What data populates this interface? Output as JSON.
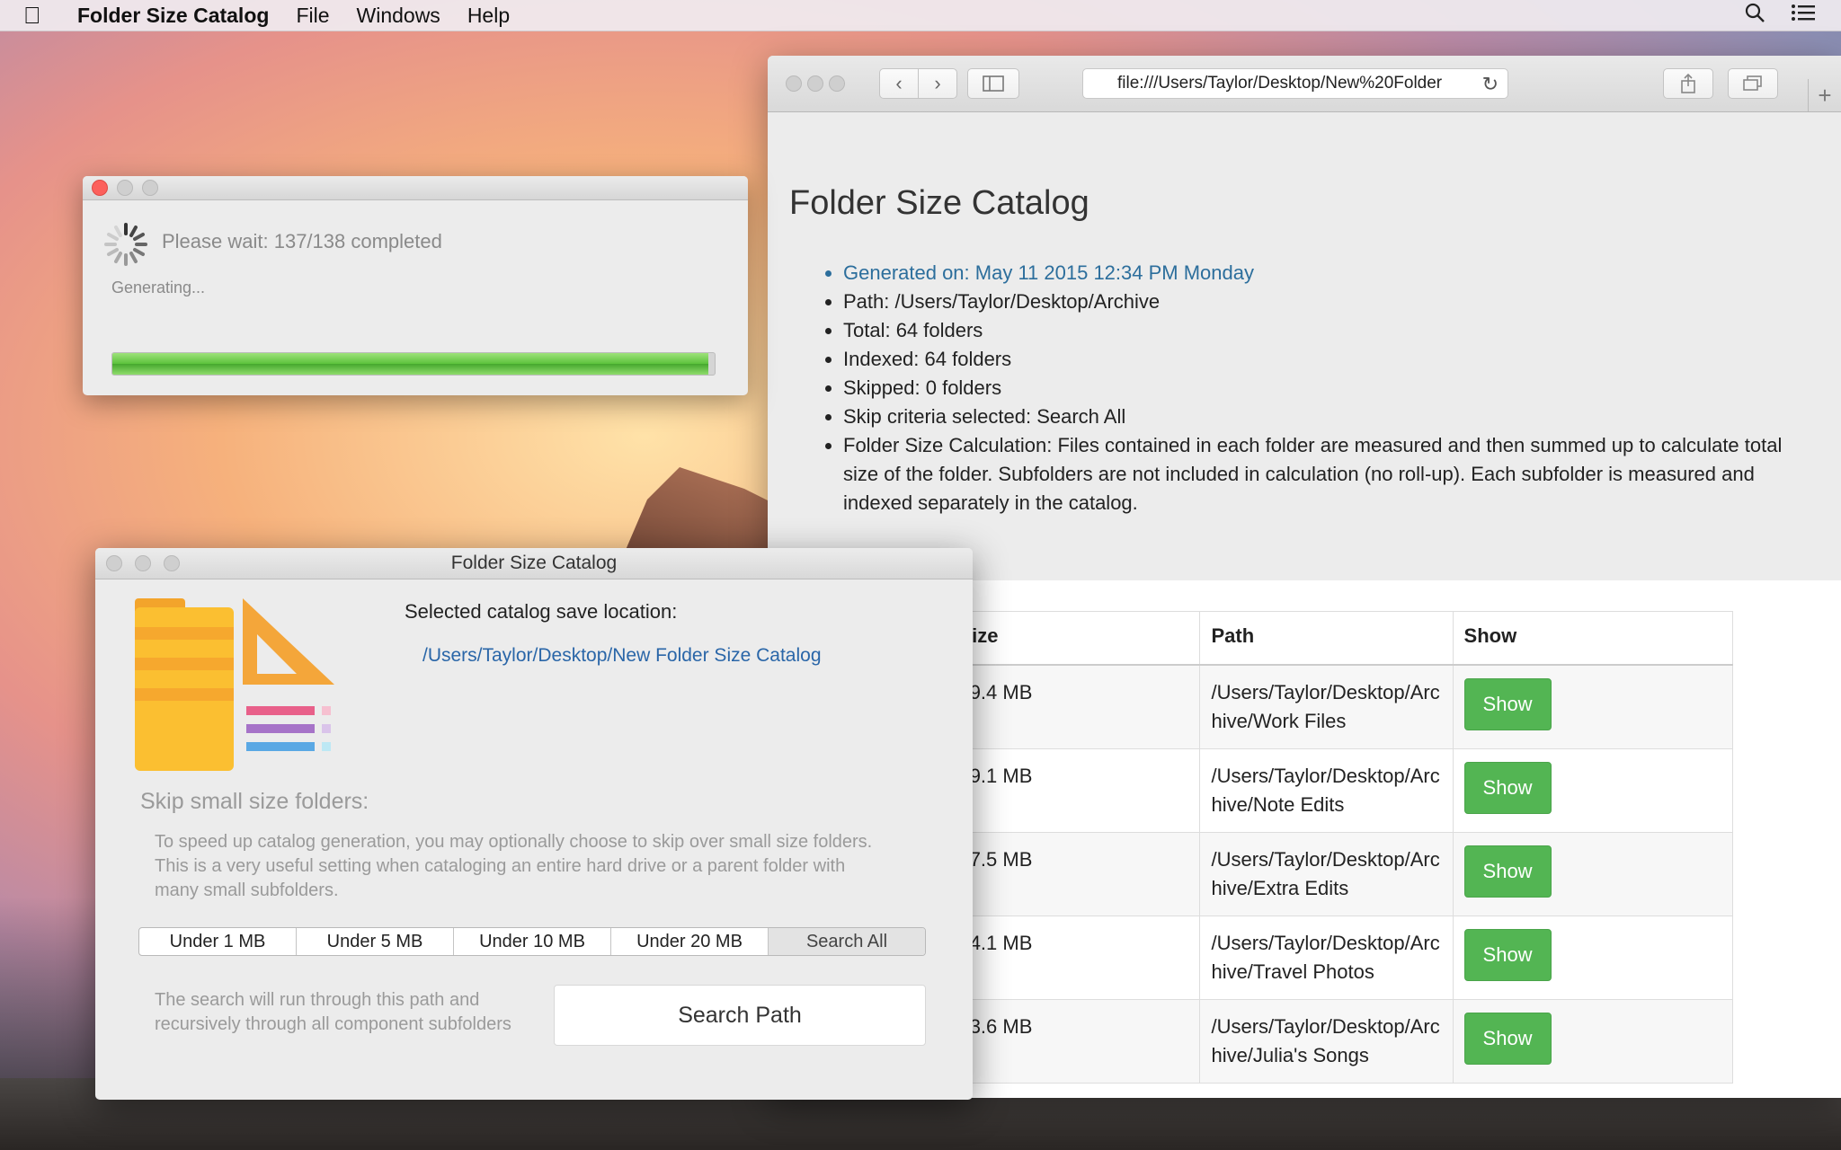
{
  "menubar": {
    "app_name": "Folder Size Catalog",
    "items": [
      "File",
      "Windows",
      "Help"
    ]
  },
  "browser": {
    "url": "file:///Users/Taylor/Desktop/New%20Folder",
    "page_title": "Folder Size Catalog",
    "info": [
      "Generated on: May 11 2015 12:34 PM Monday",
      "Path: /Users/Taylor/Desktop/Archive",
      "Total: 64 folders",
      "Indexed: 64 folders",
      "Skipped: 0 folders",
      "Skip criteria selected: Search All",
      "Folder Size Calculation: Files contained in each folder are measured and then summed up to calculate total size of the folder. Subfolders are not included in calculation (no roll-up). Each subfolder is measured and indexed separately in the catalog."
    ],
    "table": {
      "headers": [
        "Size",
        "Path",
        "Show"
      ],
      "rows": [
        {
          "size": "69.4 MB",
          "path": "/Users/Taylor/Desktop/Archive/Work Files",
          "show": "Show"
        },
        {
          "size": "69.1 MB",
          "path": "/Users/Taylor/Desktop/Archive/Note Edits",
          "show": "Show"
        },
        {
          "size": "47.5 MB",
          "path": "/Users/Taylor/Desktop/Archive/Extra Edits",
          "show": "Show"
        },
        {
          "size": "44.1 MB",
          "path": "/Users/Taylor/Desktop/Archive/Travel Photos",
          "show": "Show"
        },
        {
          "size": "33.6 MB",
          "path": "/Users/Taylor/Desktop/Archive/Julia's Songs",
          "show": "Show"
        }
      ]
    }
  },
  "progress": {
    "status": "Please wait: 137/138 completed",
    "sub_status": "Generating...",
    "fraction": 0.99
  },
  "app_window": {
    "title": "Folder Size Catalog",
    "save_label": "Selected catalog save location:",
    "save_path": "/Users/Taylor/Desktop/New Folder Size Catalog",
    "skip_heading": "Skip small size folders:",
    "skip_description": "To speed up catalog generation, you may optionally choose to skip over small size folders.  This is a very useful setting when cataloging an entire hard drive or a parent folder with many small subfolders.",
    "segments": [
      "Under 1 MB",
      "Under 5 MB",
      "Under 10 MB",
      "Under 20 MB",
      "Search All"
    ],
    "selected_segment": "Search All",
    "search_note": "The search will run through this path and recursively through all component subfolders",
    "search_button": "Search Path"
  },
  "colors": {
    "show_button": "#53b553",
    "link_blue": "#2a66a8",
    "progress_green": "#5cc23c",
    "close_red": "#fc605c"
  }
}
